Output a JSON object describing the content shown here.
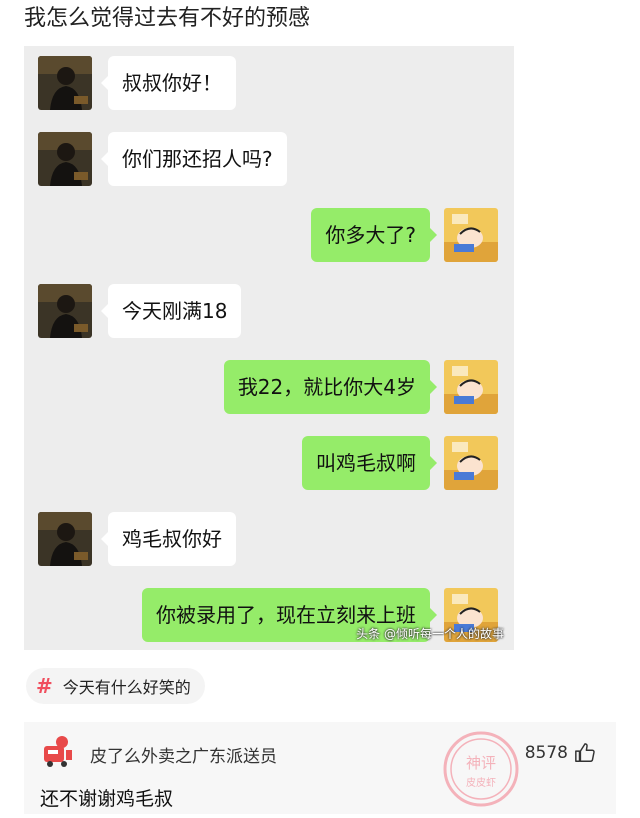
{
  "post": {
    "title": "我怎么觉得过去有不好的预感"
  },
  "chat": {
    "messages": [
      {
        "side": "left",
        "text": "叔叔你好！"
      },
      {
        "side": "left",
        "text": "你们那还招人吗?"
      },
      {
        "side": "right",
        "text": "你多大了?"
      },
      {
        "side": "left",
        "text": "今天刚满18"
      },
      {
        "side": "right",
        "text": "我22，就比你大4岁"
      },
      {
        "side": "right",
        "text": "叫鸡毛叔啊"
      },
      {
        "side": "left",
        "text": "鸡毛叔你好"
      },
      {
        "side": "right",
        "text": "你被录用了，现在立刻来上班"
      }
    ],
    "watermark": "头条 @倾听每一个人的故事"
  },
  "topic": {
    "label": "今天有什么好笑的",
    "icon": "hash-icon"
  },
  "comment": {
    "username": "皮了么外卖之广东派送员",
    "text": "还不谢谢鸡毛叔",
    "likes": "8578",
    "like_icon": "thumbs-up-icon",
    "stamp_text_1": "神评",
    "stamp_text_2": "皮皮虾"
  },
  "colors": {
    "bubble_green": "#95ec69",
    "chat_bg": "#ededed",
    "accent_red": "#f04e5e"
  }
}
